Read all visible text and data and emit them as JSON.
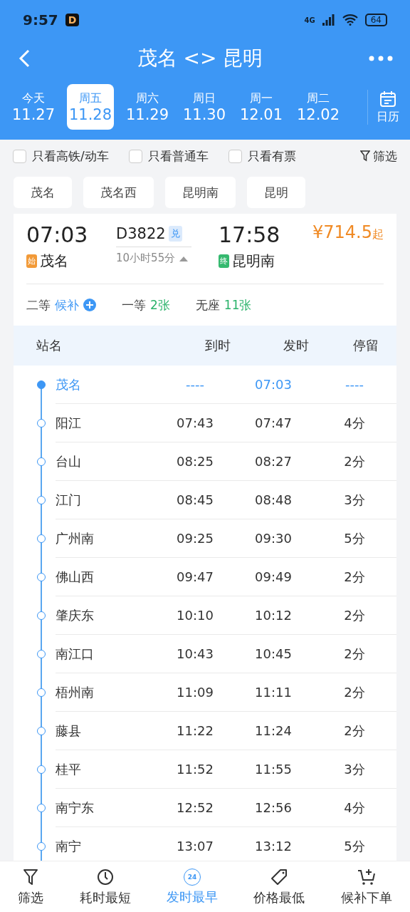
{
  "status_bar": {
    "time": "9:57",
    "app_badge": "D",
    "network": "4G",
    "battery": "64"
  },
  "header": {
    "title": "茂名 <> 昆明"
  },
  "dates": [
    {
      "weekday": "今天",
      "date": "11.27",
      "selected": false
    },
    {
      "weekday": "周五",
      "date": "11.28",
      "selected": true
    },
    {
      "weekday": "周六",
      "date": "11.29",
      "selected": false
    },
    {
      "weekday": "周日",
      "date": "11.30",
      "selected": false
    },
    {
      "weekday": "周一",
      "date": "12.01",
      "selected": false
    },
    {
      "weekday": "周二",
      "date": "12.02",
      "selected": false
    }
  ],
  "calendar": {
    "label": "日历"
  },
  "filters": [
    {
      "label": "只看高铁/动车",
      "checked": false
    },
    {
      "label": "只看普通车",
      "checked": false
    },
    {
      "label": "只看有票",
      "checked": false
    }
  ],
  "filter_button": "筛选",
  "stations": [
    "茂名",
    "茂名西",
    "昆明南",
    "昆明"
  ],
  "train": {
    "depart_time": "07:03",
    "number": "D3822",
    "exchange_tag": "兑",
    "arrive_time": "17:58",
    "price": "¥714.5",
    "price_suffix": "起",
    "origin_tag": "始",
    "origin": "茂名",
    "duration": "10小时55分",
    "expanded": true,
    "dest_tag": "终",
    "destination": "昆明南",
    "seats": [
      {
        "class": "二等",
        "availability": "候补",
        "kind": "waitlist"
      },
      {
        "class": "一等",
        "availability": "2张",
        "kind": "count"
      },
      {
        "class": "无座",
        "availability": "11张",
        "kind": "count"
      }
    ]
  },
  "stops_header": [
    "站名",
    "到时",
    "发时",
    "停留"
  ],
  "stops": [
    {
      "name": "茂名",
      "arrive": "----",
      "depart": "07:03",
      "stay": "----",
      "selected": true
    },
    {
      "name": "阳江",
      "arrive": "07:43",
      "depart": "07:47",
      "stay": "4分",
      "selected": false
    },
    {
      "name": "台山",
      "arrive": "08:25",
      "depart": "08:27",
      "stay": "2分",
      "selected": false
    },
    {
      "name": "江门",
      "arrive": "08:45",
      "depart": "08:48",
      "stay": "3分",
      "selected": false
    },
    {
      "name": "广州南",
      "arrive": "09:25",
      "depart": "09:30",
      "stay": "5分",
      "selected": false
    },
    {
      "name": "佛山西",
      "arrive": "09:47",
      "depart": "09:49",
      "stay": "2分",
      "selected": false
    },
    {
      "name": "肇庆东",
      "arrive": "10:10",
      "depart": "10:12",
      "stay": "2分",
      "selected": false
    },
    {
      "name": "南江口",
      "arrive": "10:43",
      "depart": "10:45",
      "stay": "2分",
      "selected": false
    },
    {
      "name": "梧州南",
      "arrive": "11:09",
      "depart": "11:11",
      "stay": "2分",
      "selected": false
    },
    {
      "name": "藤县",
      "arrive": "11:22",
      "depart": "11:24",
      "stay": "2分",
      "selected": false
    },
    {
      "name": "桂平",
      "arrive": "11:52",
      "depart": "11:55",
      "stay": "3分",
      "selected": false
    },
    {
      "name": "南宁东",
      "arrive": "12:52",
      "depart": "12:56",
      "stay": "4分",
      "selected": false
    },
    {
      "name": "南宁",
      "arrive": "13:07",
      "depart": "13:12",
      "stay": "5分",
      "selected": false
    }
  ],
  "bottom_bar": [
    {
      "label": "筛选",
      "kind": "filter",
      "selected": false
    },
    {
      "label": "耗时最短",
      "kind": "timer",
      "selected": false
    },
    {
      "label": "发时最早",
      "kind": "clock24",
      "badge": "24",
      "selected": true
    },
    {
      "label": "价格最低",
      "kind": "tag",
      "selected": false
    },
    {
      "label": "候补下单",
      "kind": "cart",
      "selected": false
    }
  ]
}
